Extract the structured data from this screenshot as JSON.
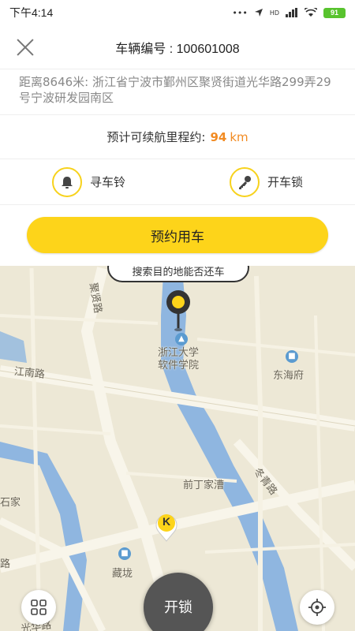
{
  "status_bar": {
    "time": "下午4:14",
    "battery": "91",
    "signal_dots": "•••",
    "network": "HD"
  },
  "header": {
    "vehicle_label": "车辆编号 : 100601008"
  },
  "address": {
    "text": "距离8646米: 浙江省宁波市鄞州区聚贤街道光华路299弄29号宁波研发园南区"
  },
  "range": {
    "label": "预计可续航里程约:",
    "value": "94",
    "unit": "km"
  },
  "actions": {
    "find_bell": "寻车铃",
    "unlock_door": "开车锁"
  },
  "book_button": "预约用车",
  "map": {
    "tooltip": "搜索目的地能否还车",
    "labels": {
      "university": "浙江大学\n软件学院",
      "donghaifu": "东海府",
      "jiangnan_road": "江南路",
      "qianding": "前丁家漕",
      "dongqing_road": "冬青路",
      "juxian_road": "聚贤路",
      "shijia": "石家",
      "zangchuan": "藏垅",
      "guanghua": "光华路",
      "lu_left": "路"
    },
    "car_marker_letter": "K"
  },
  "bottom": {
    "unlock_label": "开锁"
  },
  "colors": {
    "accent": "#fdd41a",
    "range_highlight": "#f28b22",
    "map_bg": "#ede8d6",
    "water": "#8fb6e0"
  }
}
